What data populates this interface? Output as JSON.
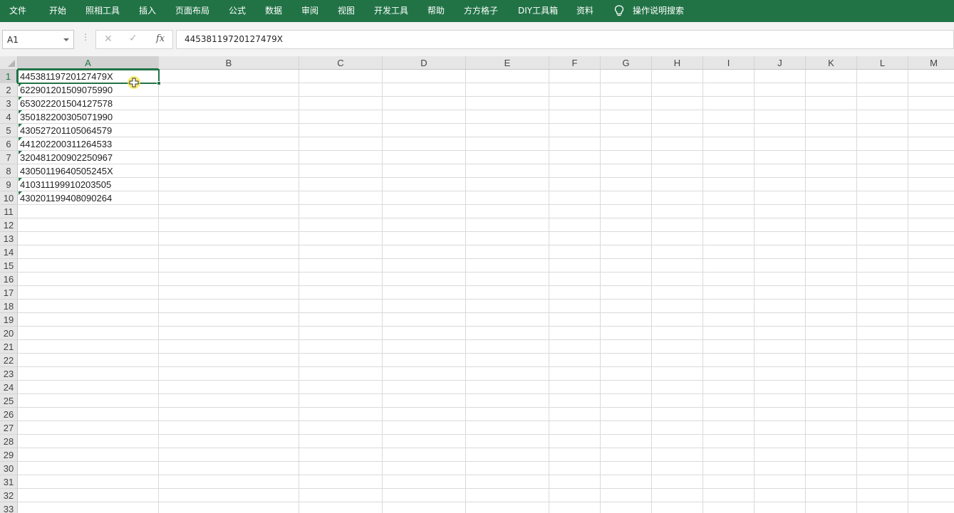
{
  "ribbon": {
    "tabs": [
      "文件",
      "开始",
      "照相工具",
      "插入",
      "页面布局",
      "公式",
      "数据",
      "审阅",
      "视图",
      "开发工具",
      "帮助",
      "方方格子",
      "DIY工具箱",
      "资料"
    ],
    "search_label": "操作说明搜索",
    "search_icon": "lightbulb-icon"
  },
  "formula_bar": {
    "name_box": "A1",
    "formula": "44538119720127479X",
    "fx_label": "fx",
    "cancel_icon": "cancel-icon",
    "enter_icon": "enter-icon"
  },
  "sheet": {
    "columns": [
      "A",
      "B",
      "C",
      "D",
      "E",
      "F",
      "G",
      "H",
      "I",
      "J",
      "K",
      "L",
      "M"
    ],
    "row_numbers": [
      "1",
      "2",
      "3",
      "4",
      "5",
      "6",
      "7",
      "8",
      "9",
      "10",
      "11",
      "12",
      "13",
      "14",
      "15",
      "16",
      "17",
      "18",
      "19",
      "20",
      "21",
      "22",
      "23",
      "24",
      "25",
      "26",
      "27",
      "28",
      "29",
      "30",
      "31",
      "32",
      "33"
    ],
    "active_cell": "A1",
    "column_a_values": [
      "44538119720127479X",
      "622901201509075990",
      "653022201504127578",
      "350182200305071990",
      "430527201105064579",
      "441202200311264533",
      "320481200902250967",
      "43050119640505245X",
      "410311199910203505",
      "430201199408090264"
    ],
    "text_number_indicator_rows": [
      2,
      3,
      4,
      5,
      6,
      7,
      9,
      10
    ],
    "accent_color": "#217346"
  }
}
